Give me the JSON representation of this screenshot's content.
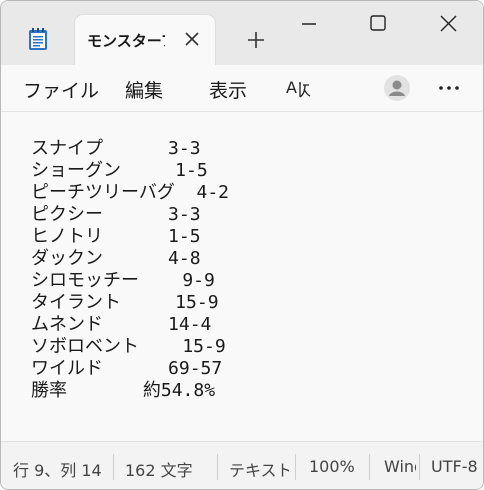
{
  "tab": {
    "title": "モンスターフ"
  },
  "menu": {
    "file": "ファイル",
    "edit": "編集",
    "view": "表示",
    "ai_icon": "copilot-icon",
    "account_icon": "account-icon",
    "more_icon": "more-icon"
  },
  "document": {
    "lines": [
      "スナイプ      3-3",
      "ショーグン     1-5",
      "ピーチツリーバグ  4-2",
      "ピクシー      3-3",
      "ヒノトリ      1-5",
      "ダックン      4-8",
      "シロモッチー    9-9",
      "タイラント     15-9",
      "ムネンド      14-4",
      "ソボロベント    15-9",
      "ワイルド      69-57",
      "勝率       約54.8%"
    ]
  },
  "status": {
    "position": "行 9、列 14",
    "chars": "162 文字",
    "format": "テキスト",
    "zoom": "100%",
    "line_ending": "Windows (CRLF)",
    "encoding": "UTF-8"
  }
}
